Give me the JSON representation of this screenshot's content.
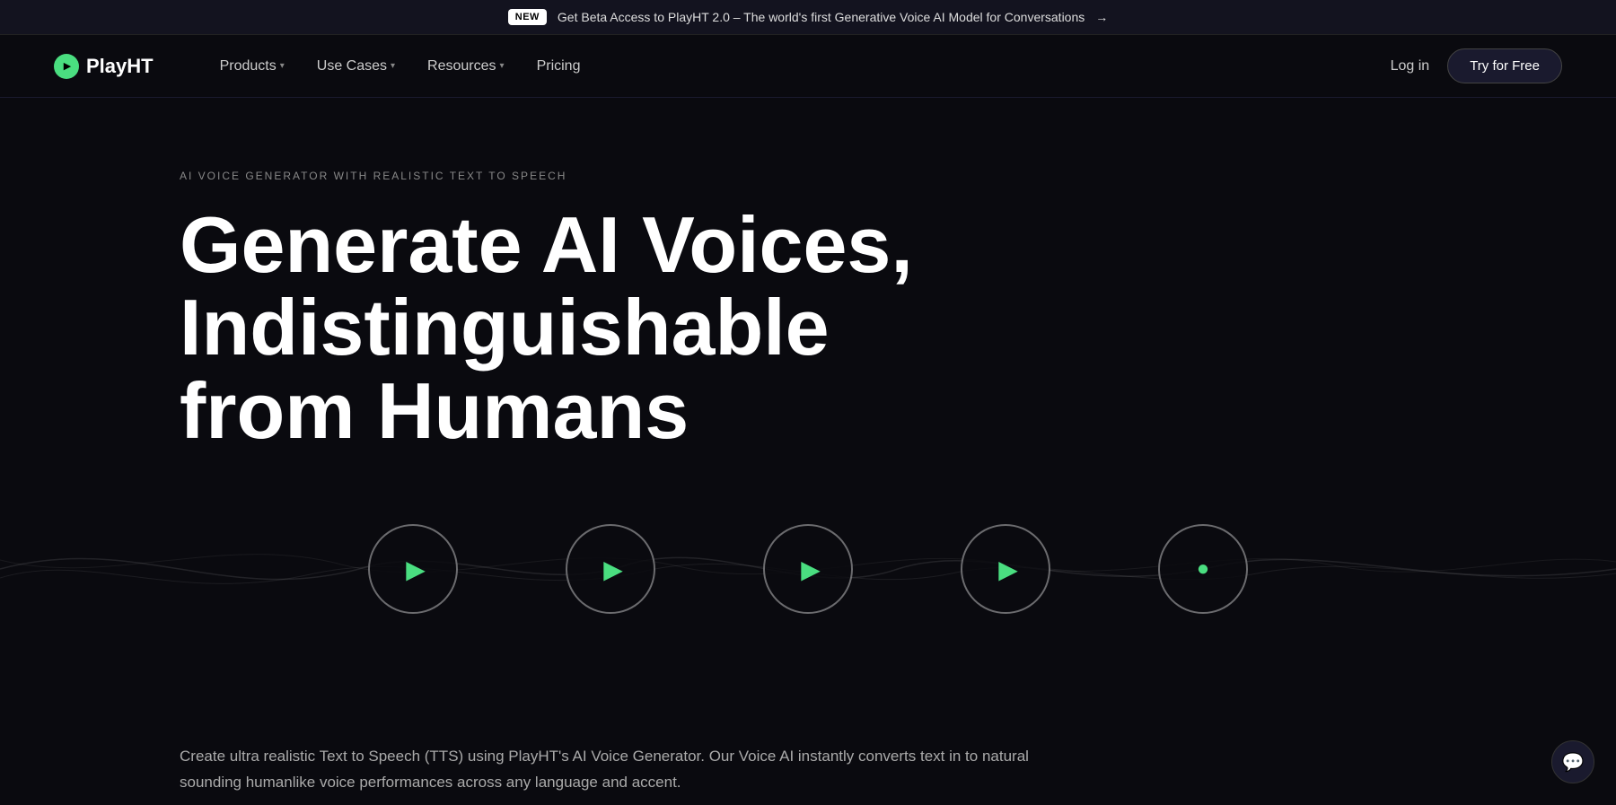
{
  "banner": {
    "badge": "NEW",
    "text": "Get Beta Access to PlayHT 2.0 – The world's first Generative Voice AI Model for Conversations",
    "arrow": "→"
  },
  "nav": {
    "logo_text": "PlayHT",
    "products_label": "Products",
    "use_cases_label": "Use Cases",
    "resources_label": "Resources",
    "pricing_label": "Pricing",
    "login_label": "Log in",
    "try_free_label": "Try for Free"
  },
  "hero": {
    "eyebrow": "AI VOICE GENERATOR WITH REALISTIC TEXT TO SPEECH",
    "title_line1": "Generate AI Voices,",
    "title_line2": "Indistinguishable from Humans",
    "description": "Create ultra realistic Text to Speech (TTS) using PlayHT's AI Voice Generator. Our Voice AI instantly converts text in to natural sounding humanlike voice performances across any language and accent."
  },
  "audio_players": [
    {
      "id": 1,
      "type": "play"
    },
    {
      "id": 2,
      "type": "play"
    },
    {
      "id": 3,
      "type": "play"
    },
    {
      "id": 4,
      "type": "play"
    },
    {
      "id": 5,
      "type": "dot"
    }
  ],
  "colors": {
    "accent": "#4ade80",
    "background": "#0a0a0f",
    "banner_bg": "#13131f"
  }
}
